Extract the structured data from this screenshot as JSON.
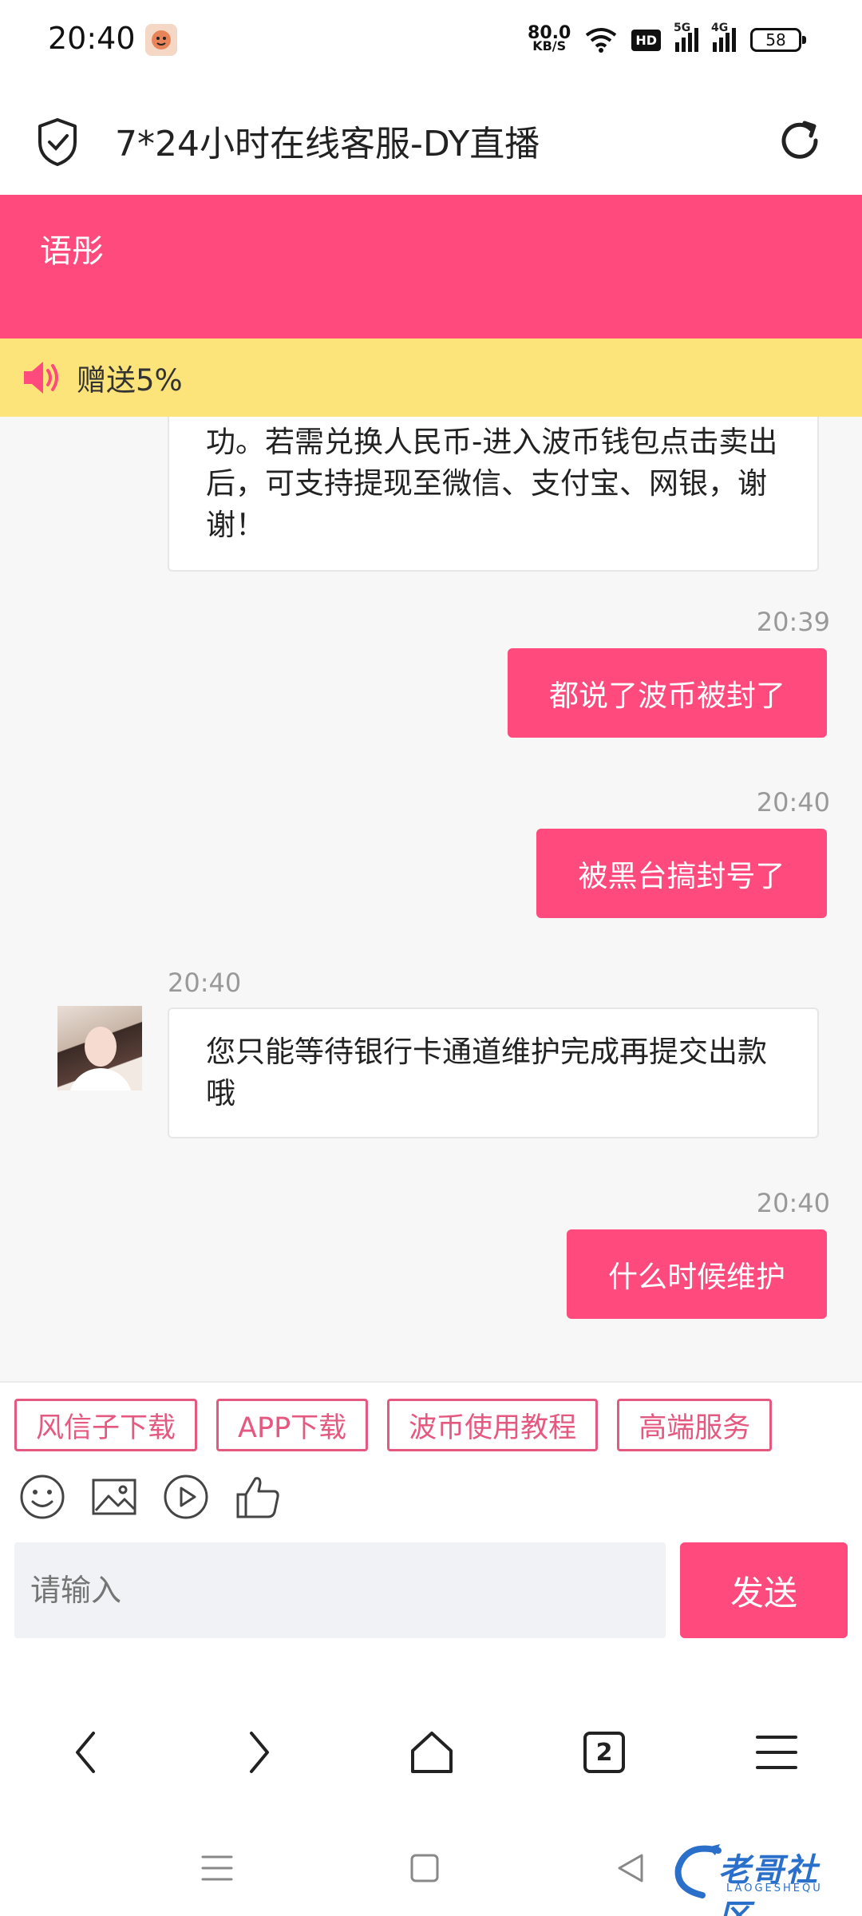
{
  "status_bar": {
    "time": "20:40",
    "net_speed_value": "80.0",
    "net_speed_unit": "KB/S",
    "hd_badge": "HD",
    "signal1_label": "5G",
    "signal2_label": "4G",
    "battery": "58"
  },
  "browser": {
    "title": "7*24小时在线客服-DY直播",
    "tab_count": "2"
  },
  "chat": {
    "agent_name": "语彤",
    "notice": "赠送5%",
    "messages": [
      {
        "side": "left",
        "time": "",
        "text": "功。若需兑换人民币-进入波币钱包点击卖出后，可支持提现至微信、支付宝、网银，谢谢！"
      },
      {
        "side": "right",
        "time": "20:39",
        "text": "都说了波币被封了"
      },
      {
        "side": "right",
        "time": "20:40",
        "text": "被黑台搞封号了"
      },
      {
        "side": "left",
        "time": "20:40",
        "text": "您只能等待银行卡通道维护完成再提交出款哦"
      },
      {
        "side": "right",
        "time": "20:40",
        "text": "什么时候维护"
      }
    ]
  },
  "quick_replies": [
    "风信子下载",
    "APP下载",
    "波币使用教程",
    "高端服务"
  ],
  "tools": [
    "emoji-icon",
    "image-icon",
    "video-icon",
    "thumbs-up-icon"
  ],
  "input": {
    "placeholder": "请输入",
    "send_label": "发送"
  },
  "watermark": {
    "text": "老哥社区",
    "sub": "LAOGESHEQU"
  },
  "colors": {
    "accent": "#ff4a7d",
    "notice_bg": "#fde47a"
  }
}
